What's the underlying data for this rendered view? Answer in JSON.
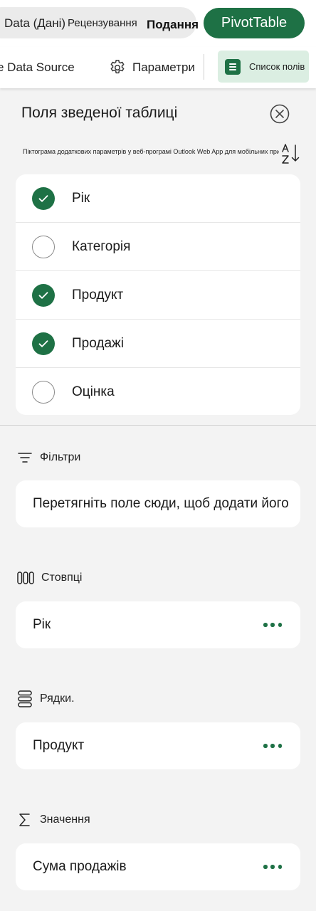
{
  "tabs": {
    "data": "Data (Дані)",
    "review": "Рецензування",
    "view": "Подання",
    "pivot": "PivotTable"
  },
  "ribbon": {
    "data_source": "e Data Source",
    "parameters": "Параметри",
    "field_list": "Список полів"
  },
  "panel": {
    "title": "Поля зведеної таблиці",
    "alt_text": "Піктограма додаткових параметрів у веб-програмі Outlook Web App для мобільних пристроїв"
  },
  "fields": [
    {
      "label": "Рік",
      "checked": true
    },
    {
      "label": "Категорія",
      "checked": false
    },
    {
      "label": "Продукт",
      "checked": true
    },
    {
      "label": "Продажі",
      "checked": true
    },
    {
      "label": "Оцінка",
      "checked": false
    }
  ],
  "areas": {
    "filters": {
      "title": "Фільтри",
      "placeholder": "Перетягніть поле сюди, щоб додати його"
    },
    "columns": {
      "title": "Стовпці",
      "value": "Рік"
    },
    "rows": {
      "title": "Рядки.",
      "value": "Продукт"
    },
    "values": {
      "title": "Значення",
      "value": "Сума продажів"
    }
  },
  "icons": {
    "settings": "gear-icon",
    "field_list": "list-icon",
    "close": "close-circle-icon",
    "sort": "sort-az-icon",
    "filters": "filter-icon",
    "columns": "columns-icon",
    "rows": "rows-icon",
    "values": "sigma-icon",
    "more": "more-horizontal-icon"
  },
  "colors": {
    "accent": "#1e7145",
    "accent_light": "#dbeee2",
    "background": "#f3f3f3"
  }
}
